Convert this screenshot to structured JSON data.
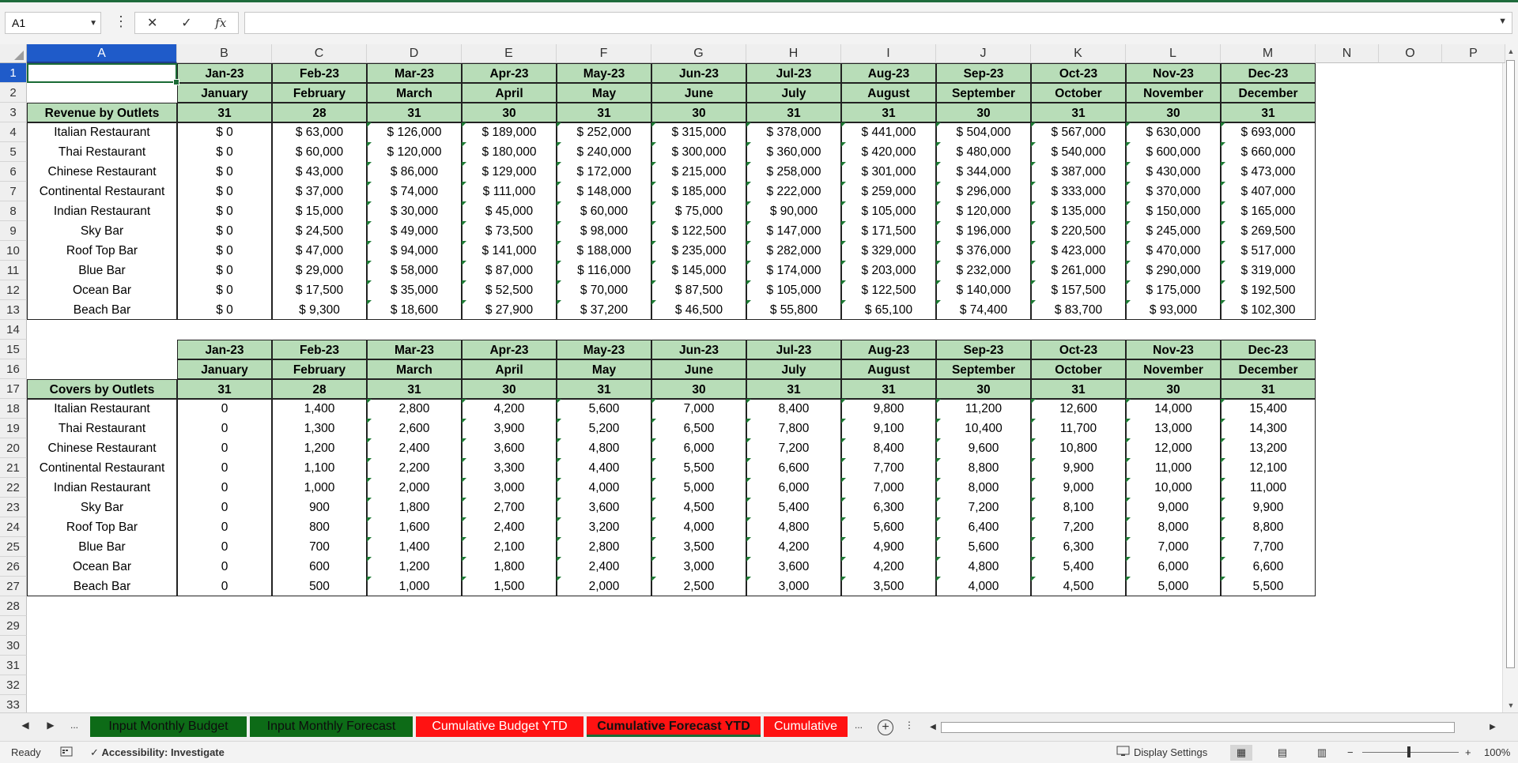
{
  "window": {
    "accent": "#1e6b3b"
  },
  "formula_bar": {
    "name_box": "A1",
    "formula": "",
    "cancel_icon": "✕",
    "enter_icon": "✓",
    "fx_label": "fx"
  },
  "columns": [
    "A",
    "B",
    "C",
    "D",
    "E",
    "F",
    "G",
    "H",
    "I",
    "J",
    "K",
    "L",
    "M",
    "N",
    "O",
    "P"
  ],
  "rows": [
    "1",
    "2",
    "3",
    "4",
    "5",
    "6",
    "7",
    "8",
    "9",
    "10",
    "11",
    "12",
    "13",
    "14",
    "15",
    "16",
    "17",
    "18",
    "19",
    "20",
    "21",
    "22",
    "23",
    "24",
    "25",
    "26",
    "27",
    "28",
    "29",
    "30",
    "31",
    "32",
    "33"
  ],
  "selected_cell": "A1",
  "header_fill": "#b8ddb8",
  "revenue_table": {
    "header_months": [
      "Jan-23",
      "Feb-23",
      "Mar-23",
      "Apr-23",
      "May-23",
      "Jun-23",
      "Jul-23",
      "Aug-23",
      "Sep-23",
      "Oct-23",
      "Nov-23",
      "Dec-23"
    ],
    "header_names": [
      "January",
      "February",
      "March",
      "April",
      "May",
      "June",
      "July",
      "August",
      "September",
      "October",
      "November",
      "December"
    ],
    "header_days": [
      "31",
      "28",
      "31",
      "30",
      "31",
      "30",
      "31",
      "31",
      "30",
      "31",
      "30",
      "31"
    ],
    "label": "Revenue by Outlets",
    "rows": [
      {
        "outlet": "Italian Restaurant",
        "values": [
          "$ 0",
          "$ 63,000",
          "$ 126,000",
          "$ 189,000",
          "$ 252,000",
          "$ 315,000",
          "$ 378,000",
          "$ 441,000",
          "$ 504,000",
          "$ 567,000",
          "$ 630,000",
          "$ 693,000"
        ]
      },
      {
        "outlet": "Thai Restaurant",
        "values": [
          "$ 0",
          "$ 60,000",
          "$ 120,000",
          "$ 180,000",
          "$ 240,000",
          "$ 300,000",
          "$ 360,000",
          "$ 420,000",
          "$ 480,000",
          "$ 540,000",
          "$ 600,000",
          "$ 660,000"
        ]
      },
      {
        "outlet": "Chinese Restaurant",
        "values": [
          "$ 0",
          "$ 43,000",
          "$ 86,000",
          "$ 129,000",
          "$ 172,000",
          "$ 215,000",
          "$ 258,000",
          "$ 301,000",
          "$ 344,000",
          "$ 387,000",
          "$ 430,000",
          "$ 473,000"
        ]
      },
      {
        "outlet": "Continental Restaurant",
        "values": [
          "$ 0",
          "$ 37,000",
          "$ 74,000",
          "$ 111,000",
          "$ 148,000",
          "$ 185,000",
          "$ 222,000",
          "$ 259,000",
          "$ 296,000",
          "$ 333,000",
          "$ 370,000",
          "$ 407,000"
        ]
      },
      {
        "outlet": "Indian Restaurant",
        "values": [
          "$ 0",
          "$ 15,000",
          "$ 30,000",
          "$ 45,000",
          "$ 60,000",
          "$ 75,000",
          "$ 90,000",
          "$ 105,000",
          "$ 120,000",
          "$ 135,000",
          "$ 150,000",
          "$ 165,000"
        ]
      },
      {
        "outlet": "Sky Bar",
        "values": [
          "$ 0",
          "$ 24,500",
          "$ 49,000",
          "$ 73,500",
          "$ 98,000",
          "$ 122,500",
          "$ 147,000",
          "$ 171,500",
          "$ 196,000",
          "$ 220,500",
          "$ 245,000",
          "$ 269,500"
        ]
      },
      {
        "outlet": "Roof Top Bar",
        "values": [
          "$ 0",
          "$ 47,000",
          "$ 94,000",
          "$ 141,000",
          "$ 188,000",
          "$ 235,000",
          "$ 282,000",
          "$ 329,000",
          "$ 376,000",
          "$ 423,000",
          "$ 470,000",
          "$ 517,000"
        ]
      },
      {
        "outlet": "Blue Bar",
        "values": [
          "$ 0",
          "$ 29,000",
          "$ 58,000",
          "$ 87,000",
          "$ 116,000",
          "$ 145,000",
          "$ 174,000",
          "$ 203,000",
          "$ 232,000",
          "$ 261,000",
          "$ 290,000",
          "$ 319,000"
        ]
      },
      {
        "outlet": "Ocean Bar",
        "values": [
          "$ 0",
          "$ 17,500",
          "$ 35,000",
          "$ 52,500",
          "$ 70,000",
          "$ 87,500",
          "$ 105,000",
          "$ 122,500",
          "$ 140,000",
          "$ 157,500",
          "$ 175,000",
          "$ 192,500"
        ]
      },
      {
        "outlet": "Beach Bar",
        "values": [
          "$ 0",
          "$ 9,300",
          "$ 18,600",
          "$ 27,900",
          "$ 37,200",
          "$ 46,500",
          "$ 55,800",
          "$ 65,100",
          "$ 74,400",
          "$ 83,700",
          "$ 93,000",
          "$ 102,300"
        ]
      }
    ]
  },
  "covers_table": {
    "header_months": [
      "Jan-23",
      "Feb-23",
      "Mar-23",
      "Apr-23",
      "May-23",
      "Jun-23",
      "Jul-23",
      "Aug-23",
      "Sep-23",
      "Oct-23",
      "Nov-23",
      "Dec-23"
    ],
    "header_names": [
      "January",
      "February",
      "March",
      "April",
      "May",
      "June",
      "July",
      "August",
      "September",
      "October",
      "November",
      "December"
    ],
    "header_days": [
      "31",
      "28",
      "31",
      "30",
      "31",
      "30",
      "31",
      "31",
      "30",
      "31",
      "30",
      "31"
    ],
    "label": "Covers by Outlets",
    "rows": [
      {
        "outlet": "Italian Restaurant",
        "values": [
          "0",
          "1,400",
          "2,800",
          "4,200",
          "5,600",
          "7,000",
          "8,400",
          "9,800",
          "11,200",
          "12,600",
          "14,000",
          "15,400"
        ]
      },
      {
        "outlet": "Thai Restaurant",
        "values": [
          "0",
          "1,300",
          "2,600",
          "3,900",
          "5,200",
          "6,500",
          "7,800",
          "9,100",
          "10,400",
          "11,700",
          "13,000",
          "14,300"
        ]
      },
      {
        "outlet": "Chinese Restaurant",
        "values": [
          "0",
          "1,200",
          "2,400",
          "3,600",
          "4,800",
          "6,000",
          "7,200",
          "8,400",
          "9,600",
          "10,800",
          "12,000",
          "13,200"
        ]
      },
      {
        "outlet": "Continental Restaurant",
        "values": [
          "0",
          "1,100",
          "2,200",
          "3,300",
          "4,400",
          "5,500",
          "6,600",
          "7,700",
          "8,800",
          "9,900",
          "11,000",
          "12,100"
        ]
      },
      {
        "outlet": "Indian Restaurant",
        "values": [
          "0",
          "1,000",
          "2,000",
          "3,000",
          "4,000",
          "5,000",
          "6,000",
          "7,000",
          "8,000",
          "9,000",
          "10,000",
          "11,000"
        ]
      },
      {
        "outlet": "Sky Bar",
        "values": [
          "0",
          "900",
          "1,800",
          "2,700",
          "3,600",
          "4,500",
          "5,400",
          "6,300",
          "7,200",
          "8,100",
          "9,000",
          "9,900"
        ]
      },
      {
        "outlet": "Roof Top Bar",
        "values": [
          "0",
          "800",
          "1,600",
          "2,400",
          "3,200",
          "4,000",
          "4,800",
          "5,600",
          "6,400",
          "7,200",
          "8,000",
          "8,800"
        ]
      },
      {
        "outlet": "Blue Bar",
        "values": [
          "0",
          "700",
          "1,400",
          "2,100",
          "2,800",
          "3,500",
          "4,200",
          "4,900",
          "5,600",
          "6,300",
          "7,000",
          "7,700"
        ]
      },
      {
        "outlet": "Ocean Bar",
        "values": [
          "0",
          "600",
          "1,200",
          "1,800",
          "2,400",
          "3,000",
          "3,600",
          "4,200",
          "4,800",
          "5,400",
          "6,000",
          "6,600"
        ]
      },
      {
        "outlet": "Beach Bar",
        "values": [
          "0",
          "500",
          "1,000",
          "1,500",
          "2,000",
          "2,500",
          "3,000",
          "3,500",
          "4,000",
          "4,500",
          "5,000",
          "5,500"
        ]
      }
    ]
  },
  "sheet_tabs": [
    {
      "label": "Input Monthly Budget",
      "color": "green"
    },
    {
      "label": "Input Monthly Forecast",
      "color": "green"
    },
    {
      "label": "Cumulative Budget YTD",
      "color": "red"
    },
    {
      "label": "Cumulative Forecast YTD",
      "color": "red",
      "active": true
    },
    {
      "label": "Cumulative",
      "color": "red"
    }
  ],
  "tab_nav": {
    "prev": "◀",
    "next": "▶",
    "more": "...",
    "more_right": "...",
    "add": "+",
    "options": "⋮"
  },
  "status": {
    "ready": "Ready",
    "accessibility": "Accessibility: Investigate",
    "display_settings": "Display Settings",
    "zoom": "100%",
    "zoom_minus": "−",
    "zoom_plus": "+"
  }
}
